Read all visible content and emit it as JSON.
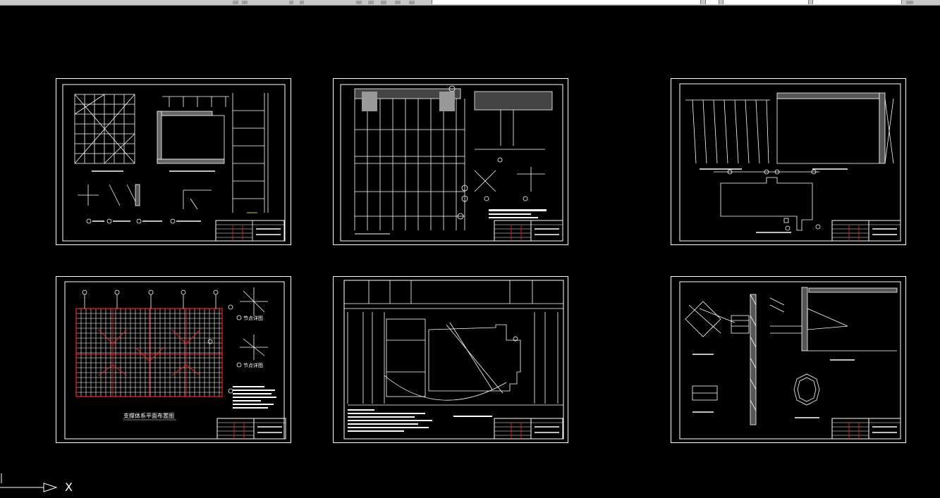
{
  "app": {
    "canvas_background": "#000000",
    "line_color": "#ffffff",
    "red_color": "#ff2020",
    "yellow_color": "#ffff40"
  },
  "ucs": {
    "x_label": "X",
    "icon": "ucs-axis-icon"
  },
  "sheets": {
    "s4": {
      "caption": "支撑体系平面布置图",
      "callouts": [
        "节点详图",
        "节点详图"
      ]
    }
  }
}
